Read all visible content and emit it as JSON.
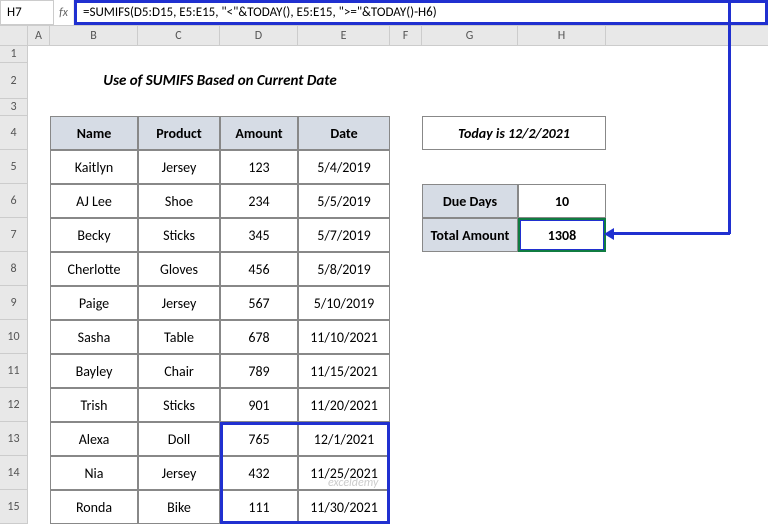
{
  "namebox": "H7",
  "formula": "=SUMIFS(D5:D15, E5:E15, \"<\"&TODAY(), E5:E15, \">=\"&TODAY()-H6)",
  "columns": [
    "A",
    "B",
    "C",
    "D",
    "E",
    "F",
    "G",
    "H"
  ],
  "rows": [
    "1",
    "2",
    "3",
    "4",
    "5",
    "6",
    "7",
    "8",
    "9",
    "10",
    "11",
    "12",
    "13",
    "14",
    "15"
  ],
  "title": "Use of SUMIFS Based on Current Date",
  "headers": {
    "name": "Name",
    "product": "Product",
    "amount": "Amount",
    "date": "Date"
  },
  "data": [
    {
      "name": "Kaitlyn",
      "product": "Jersey",
      "amount": "123",
      "date": "5/4/2019"
    },
    {
      "name": "AJ Lee",
      "product": "Shoe",
      "amount": "234",
      "date": "5/5/2019"
    },
    {
      "name": "Becky",
      "product": "Sticks",
      "amount": "345",
      "date": "5/7/2019"
    },
    {
      "name": "Cherlotte",
      "product": "Gloves",
      "amount": "456",
      "date": "5/8/2019"
    },
    {
      "name": "Paige",
      "product": "Jersey",
      "amount": "567",
      "date": "5/10/2019"
    },
    {
      "name": "Sasha",
      "product": "Table",
      "amount": "678",
      "date": "11/10/2021"
    },
    {
      "name": "Bayley",
      "product": "Chair",
      "amount": "789",
      "date": "11/15/2021"
    },
    {
      "name": "Trish",
      "product": "Sticks",
      "amount": "901",
      "date": "11/20/2021"
    },
    {
      "name": "Alexa",
      "product": "Doll",
      "amount": "765",
      "date": "12/1/2021"
    },
    {
      "name": "Nia",
      "product": "Jersey",
      "amount": "432",
      "date": "11/25/2021"
    },
    {
      "name": "Ronda",
      "product": "Bike",
      "amount": "111",
      "date": "11/30/2021"
    }
  ],
  "side": {
    "today": "Today is 12/2/2021",
    "due_label": "Due Days",
    "due_value": "10",
    "total_label": "Total Amount",
    "total_value": "1308"
  },
  "watermark": "exceldemy"
}
